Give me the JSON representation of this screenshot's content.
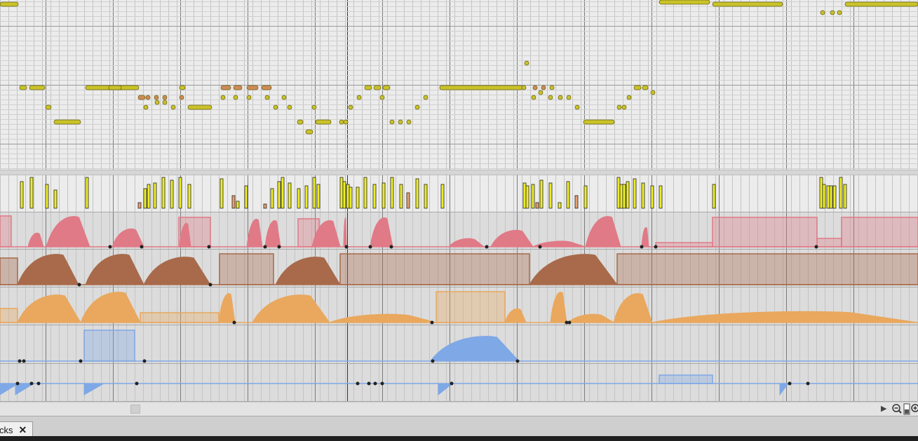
{
  "tab": {
    "label": "cks",
    "close_glyph": "✕"
  },
  "transport": {
    "play_glyph": "▶"
  },
  "colors": {
    "note": "#c9c22a",
    "note_selected": "#d08a5a",
    "velocity": "#eded2a",
    "velocity_alt": "#e8a070",
    "lane1": "#e07a86",
    "lane2": "#a86a4a",
    "lane3": "#e9a85e",
    "lane4": "#7fa8e6",
    "lane5": "#7fa8e6"
  },
  "icons": [
    "zoom-out-icon",
    "zoom-slider-icon",
    "zoom-in-icon",
    "play-arrow-icon",
    "close-icon"
  ]
}
